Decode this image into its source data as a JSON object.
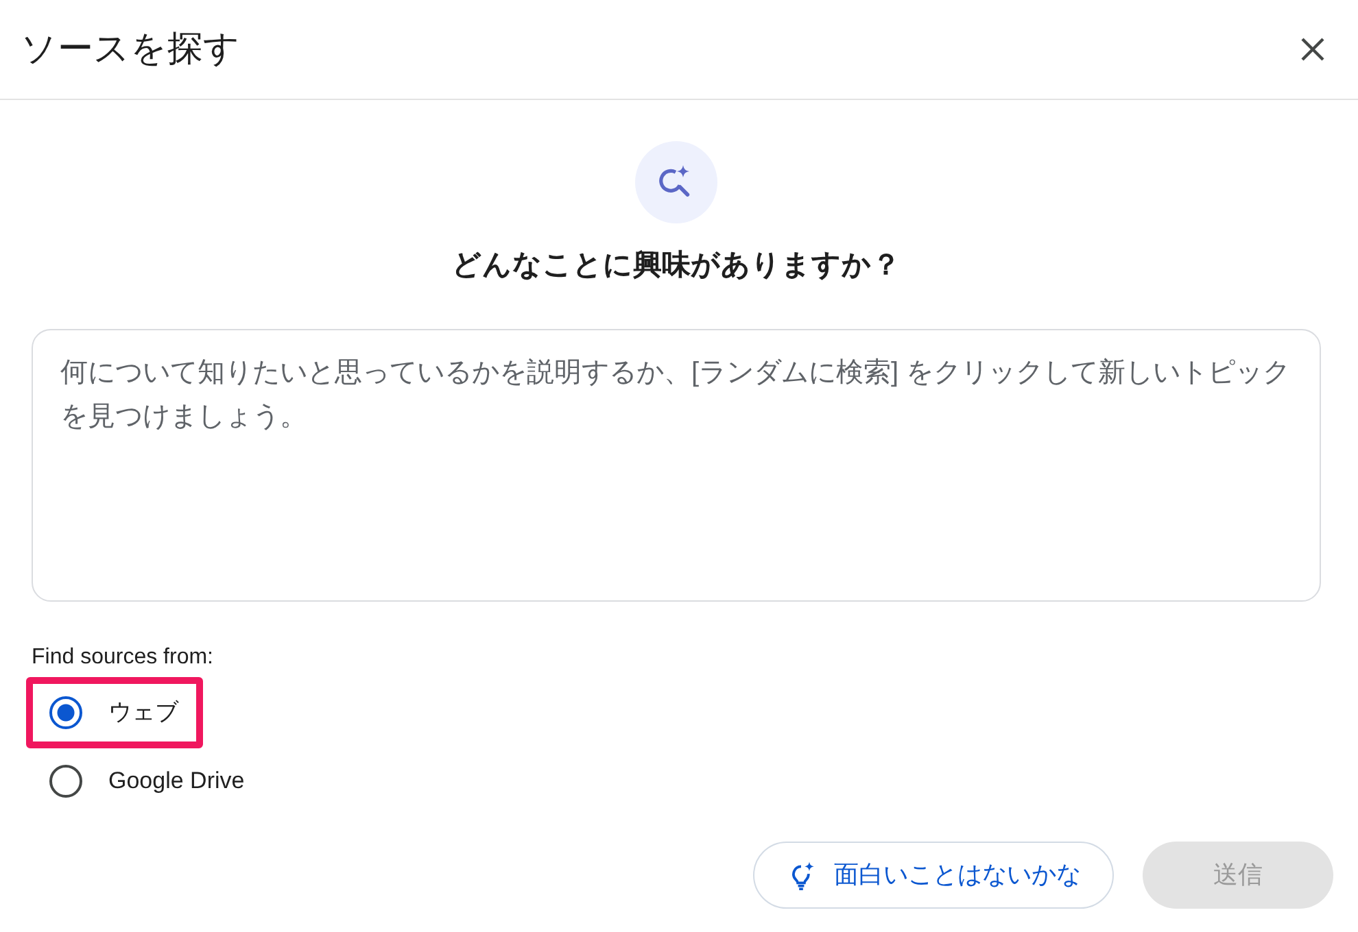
{
  "dialog": {
    "title": "ソースを探す"
  },
  "prompt": {
    "heading": "どんなことに興味がありますか？"
  },
  "query": {
    "placeholder": "何について知りたいと思っているかを説明するか、[ランダムに検索] をクリックして新しいトピックを見つけましょう。"
  },
  "sources": {
    "label": "Find sources from:",
    "options": [
      {
        "label": "ウェブ",
        "selected": true,
        "highlighted": true
      },
      {
        "label": "Google Drive",
        "selected": false,
        "highlighted": false
      }
    ]
  },
  "actions": [
    {
      "kind": "suggest",
      "label": "面白いことはないかな",
      "disabled": false
    },
    {
      "kind": "submit",
      "label": "送信",
      "disabled": true
    }
  ]
}
